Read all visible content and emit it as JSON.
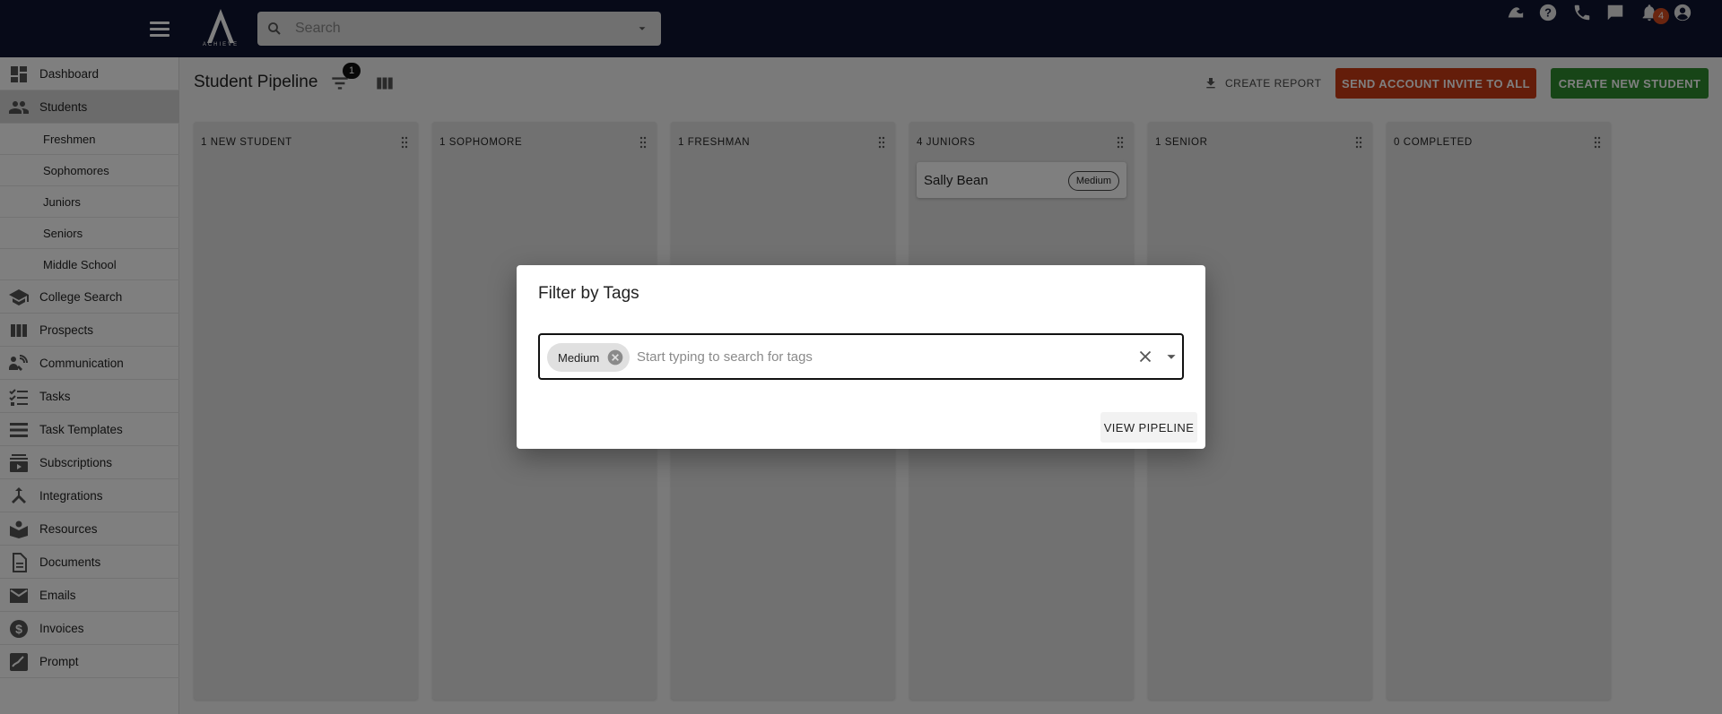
{
  "topbar": {
    "logo_text": "ACHIEVE",
    "search_placeholder": "Search",
    "notification_count": "4",
    "icons": [
      "menu-icon",
      "logo",
      "search-icon",
      "caret-down-icon",
      "graduation-icon",
      "help-icon",
      "phone-icon",
      "chat-icon",
      "bell-icon",
      "account-icon"
    ]
  },
  "sidebar": {
    "items": [
      {
        "label": "Dashboard",
        "icon": "dashboard-icon"
      },
      {
        "label": "Students",
        "icon": "people-icon",
        "active": true
      },
      {
        "label": "Freshmen",
        "sub": true
      },
      {
        "label": "Sophomores",
        "sub": true
      },
      {
        "label": "Juniors",
        "sub": true
      },
      {
        "label": "Seniors",
        "sub": true
      },
      {
        "label": "Middle School",
        "sub": true
      },
      {
        "label": "College Search",
        "icon": "school-icon"
      },
      {
        "label": "Prospects",
        "icon": "columns-icon"
      },
      {
        "label": "Communication",
        "icon": "communication-icon"
      },
      {
        "label": "Tasks",
        "icon": "tasks-icon"
      },
      {
        "label": "Task Templates",
        "icon": "list-icon"
      },
      {
        "label": "Subscriptions",
        "icon": "subscriptions-icon"
      },
      {
        "label": "Integrations",
        "icon": "merge-icon"
      },
      {
        "label": "Resources",
        "icon": "resources-icon"
      },
      {
        "label": "Documents",
        "icon": "document-icon"
      },
      {
        "label": "Emails",
        "icon": "mail-icon"
      },
      {
        "label": "Invoices",
        "icon": "dollar-icon"
      },
      {
        "label": "Prompt",
        "icon": "prompt-icon"
      }
    ]
  },
  "main": {
    "title": "Student Pipeline",
    "filter_count": "1",
    "create_report_label": "CREATE REPORT",
    "invite_all_label": "SEND ACCOUNT INVITE TO ALL",
    "create_student_label": "CREATE NEW STUDENT"
  },
  "columns": [
    {
      "title": "1 NEW STUDENT",
      "cards": []
    },
    {
      "title": "1 SOPHOMORE",
      "cards": []
    },
    {
      "title": "1 FRESHMAN",
      "cards": []
    },
    {
      "title": "4 JUNIORS",
      "cards": [
        {
          "name": "Sally Bean",
          "tag": "Medium"
        }
      ]
    },
    {
      "title": "1 SENIOR",
      "cards": []
    },
    {
      "title": "0 COMPLETED",
      "cards": []
    }
  ],
  "modal": {
    "title": "Filter by Tags",
    "selected_tag": "Medium",
    "input_placeholder": "Start typing to search for tags",
    "view_button_label": "VIEW PIPELINE"
  },
  "colors": {
    "topbar_bg": "#0e1430",
    "invite_button": "#c93a14",
    "create_button": "#2e8a2e",
    "badge": "#d44a1f"
  }
}
